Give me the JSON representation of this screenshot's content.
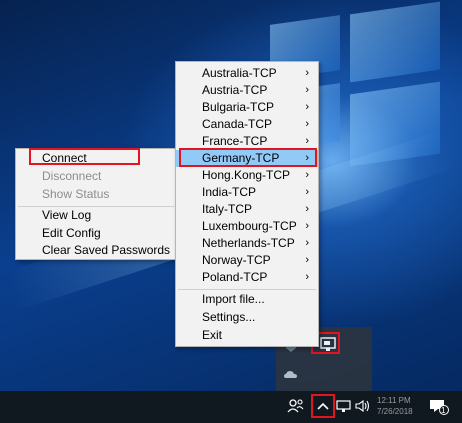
{
  "context_menu": {
    "items": [
      {
        "label": "Connect",
        "enabled": true,
        "highlighted": false
      },
      {
        "label": "Disconnect",
        "enabled": false
      },
      {
        "label": "Show Status",
        "enabled": false
      },
      {
        "label": "View Log",
        "enabled": true
      },
      {
        "label": "Edit Config",
        "enabled": true
      },
      {
        "label": "Clear Saved Passwords",
        "enabled": true
      }
    ]
  },
  "submenu": {
    "profiles": [
      "Australia-TCP",
      "Austria-TCP",
      "Bulgaria-TCP",
      "Canada-TCP",
      "France-TCP",
      "Germany-TCP",
      "Hong.Kong-TCP",
      "India-TCP",
      "Italy-TCP",
      "Luxembourg-TCP",
      "Netherlands-TCP",
      "Norway-TCP",
      "Poland-TCP"
    ],
    "highlighted_profile": "Germany-TCP",
    "arrow_glyph": "›",
    "actions": [
      "Import file...",
      "Settings...",
      "Exit"
    ]
  },
  "annotation_color": "#e0151f",
  "taskbar": {
    "clock_time": "12:11 PM",
    "clock_date": "7/26/2018",
    "notification_count": "1",
    "icons": [
      "people-icon",
      "show-hidden-icons-chevron",
      "network-icon",
      "volume-icon",
      "action-center-icon"
    ]
  },
  "tray_overflow": {
    "icons": [
      "openvpn-gui-icon",
      "security-shield-icon",
      "onedrive-icon"
    ]
  }
}
